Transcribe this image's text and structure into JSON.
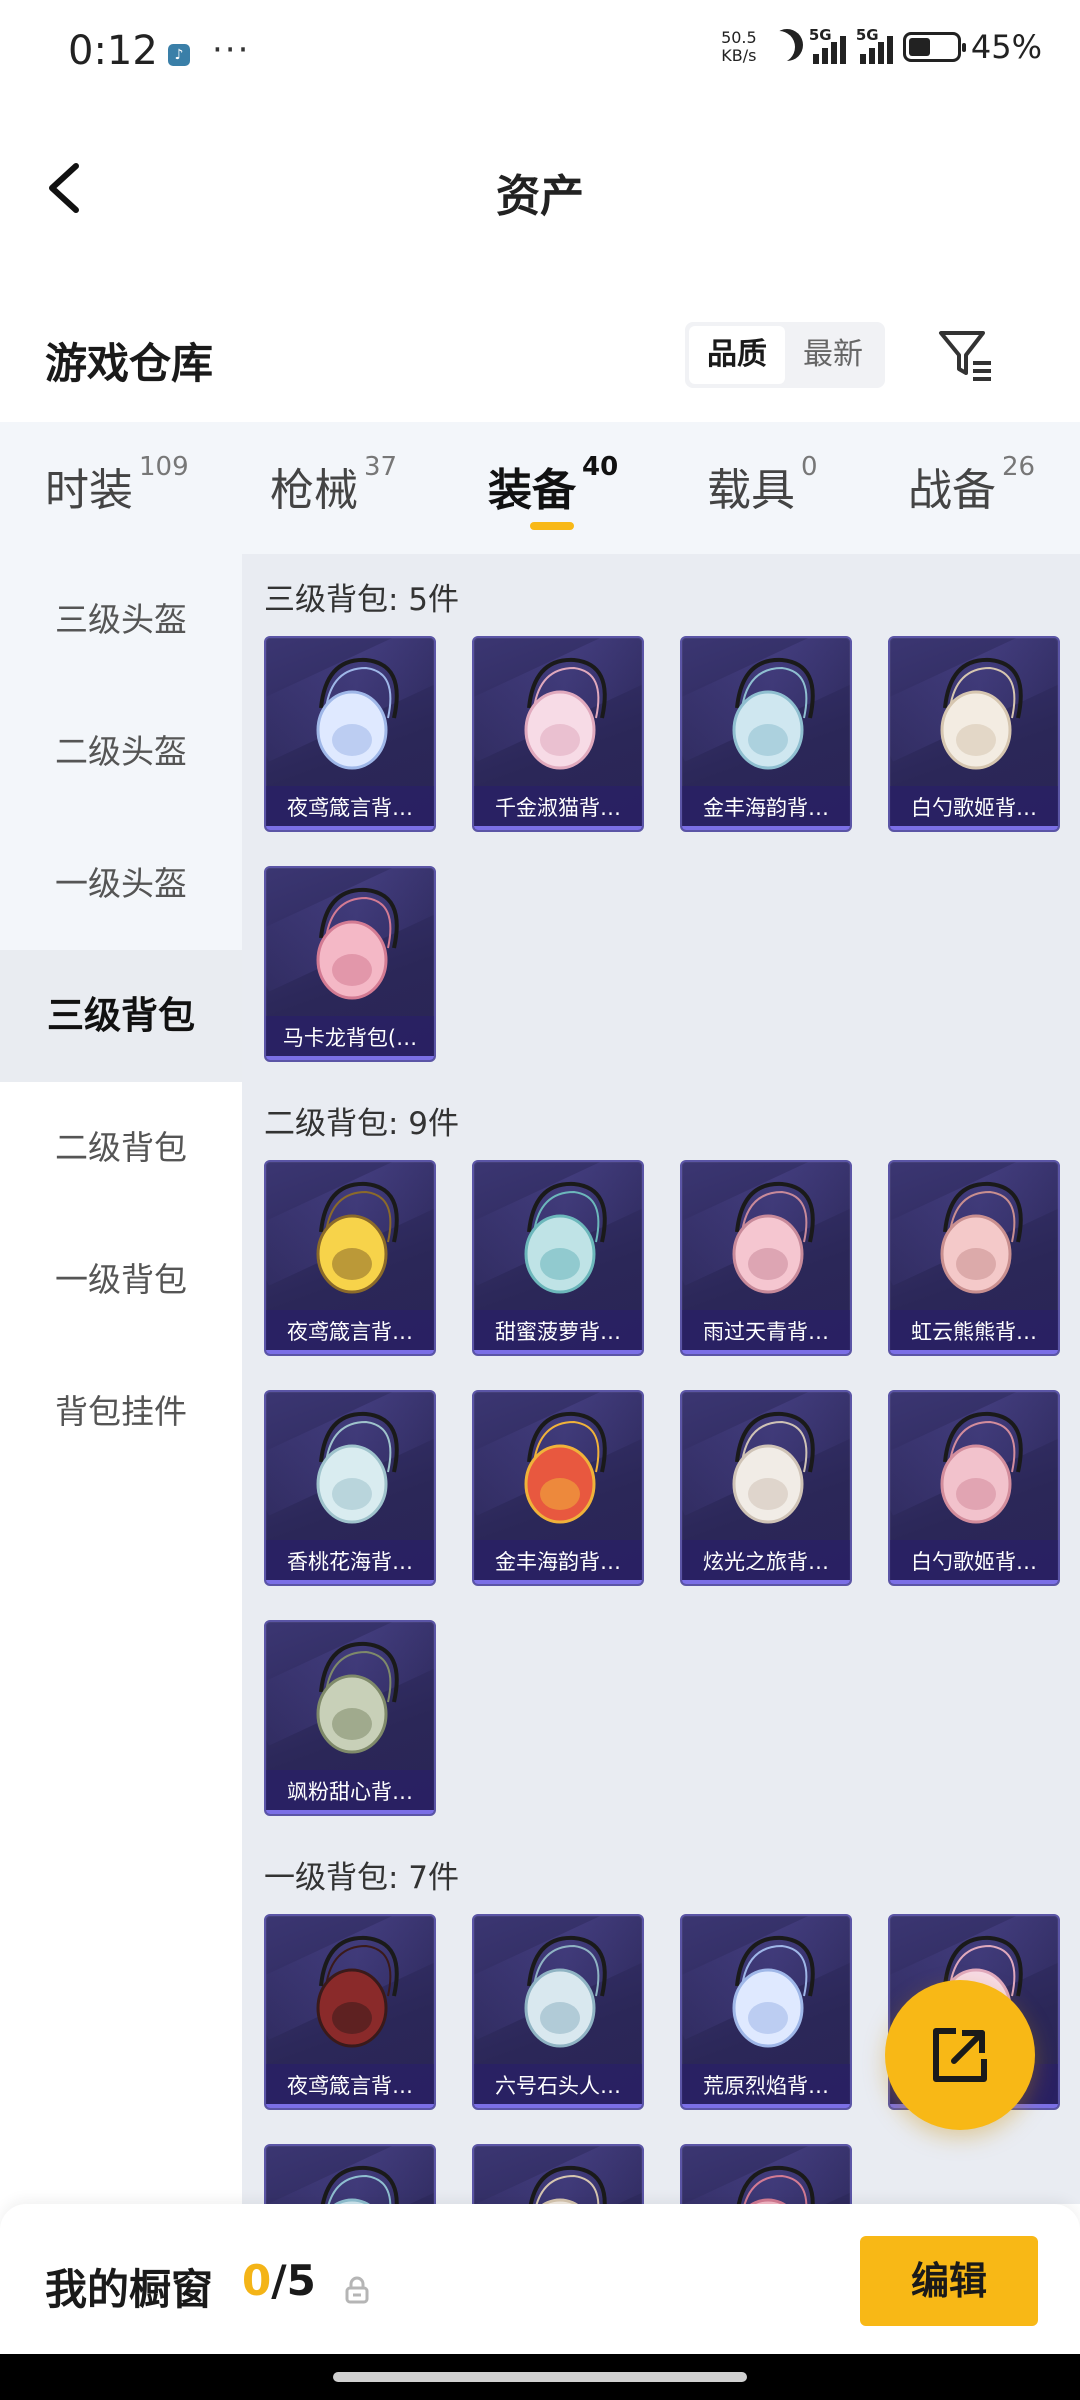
{
  "status_bar": {
    "time": "0:12",
    "net_speed_value": "50.5",
    "net_speed_unit": "KB/s",
    "signal1_label": "5G",
    "signal2_label": "5G",
    "battery_percent": "45%",
    "battery_level": 0.45
  },
  "header": {
    "title": "资产"
  },
  "warehouse": {
    "title": "游戏仓库",
    "sort_options": [
      "品质",
      "最新"
    ],
    "sort_selected": "品质"
  },
  "tabs": [
    {
      "label": "时装",
      "count": "109"
    },
    {
      "label": "枪械",
      "count": "37"
    },
    {
      "label": "装备",
      "count": "40",
      "active": true
    },
    {
      "label": "载具",
      "count": "0"
    },
    {
      "label": "战备",
      "count": "26"
    }
  ],
  "sidebar": {
    "items": [
      "三级头盔",
      "二级头盔",
      "一级头盔",
      "三级背包",
      "二级背包",
      "一级背包",
      "背包挂件"
    ],
    "active": "三级背包"
  },
  "groups": [
    {
      "title": "三级背包: 5件",
      "items": [
        "夜鸢箴言背…",
        "千金淑猫背…",
        "金丰海韵背…",
        "白勺歌姬背…",
        "马卡龙背包(…"
      ]
    },
    {
      "title": "二级背包: 9件",
      "items": [
        "夜鸢箴言背…",
        "甜蜜菠萝背…",
        "雨过天青背…",
        "虹云熊熊背…",
        "香桃花海背…",
        "金丰海韵背…",
        "炫光之旅背…",
        "白勺歌姬背…",
        "飒粉甜心背…"
      ]
    },
    {
      "title": "一级背包: 7件",
      "items": [
        "夜鸢箴言背…",
        "六号石头人…",
        "荒原烈焰背…",
        "",
        "",
        "",
        ""
      ]
    }
  ],
  "bottom": {
    "window_label": "我的橱窗",
    "window_current": "0",
    "window_total": "/5",
    "edit_label": "编辑"
  },
  "colors": {
    "accent": "#f8b816",
    "card_bg": "#2f2a60",
    "card_border": "#5b55a6"
  },
  "icons": [
    "back-icon",
    "filter-icon",
    "share-icon",
    "lock-icon",
    "moon-icon",
    "battery-icon"
  ]
}
